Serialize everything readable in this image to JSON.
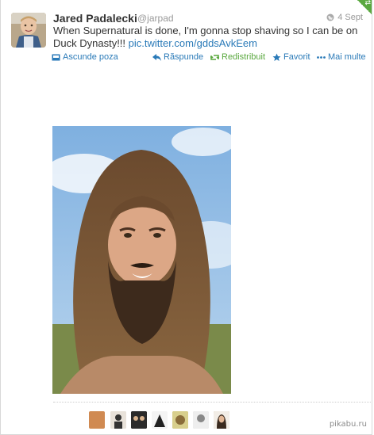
{
  "tweet": {
    "author_name": "Jared Padalecki",
    "author_handle": "@jarpad",
    "timestamp": "4 Sept",
    "text_main": "When Supernatural is done, I'm gonna stop shaving so I can be on Duck Dynasty!!! ",
    "link_text": "pic.twitter.com/gddsAvkEem"
  },
  "actions": {
    "hide_photo": "Ascunde poza",
    "reply": "Răspunde",
    "retweet": "Redistribuit",
    "favorite": "Favorit",
    "more": "Mai multe"
  },
  "favorites": {
    "avatars": [
      "avatar-1",
      "avatar-2",
      "avatar-3",
      "avatar-4",
      "avatar-5",
      "avatar-6",
      "avatar-7"
    ]
  },
  "watermark": "pikabu.ru",
  "colors": {
    "link": "#2a7ab8",
    "retweet_green": "#5aa83f",
    "muted": "#999999"
  }
}
